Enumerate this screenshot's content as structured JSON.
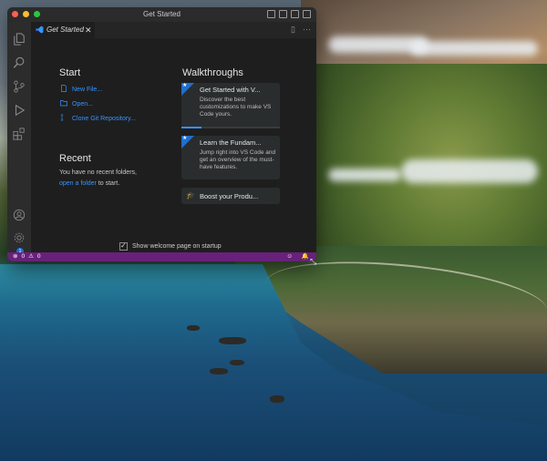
{
  "window": {
    "title": "Get Started"
  },
  "traffic_lights": {
    "close": "#ff5f57",
    "minimize": "#febc2e",
    "maximize": "#28c840"
  },
  "tab": {
    "label": "Get Started",
    "close": "✕"
  },
  "start": {
    "heading": "Start",
    "items": [
      {
        "label": "New File...",
        "icon": "new-file-icon"
      },
      {
        "label": "Open...",
        "icon": "folder-icon"
      },
      {
        "label": "Clone Git Repository...",
        "icon": "source-control-icon"
      }
    ]
  },
  "recent": {
    "heading": "Recent",
    "no_recent": "You have no recent folders,",
    "open_folder_link": "open a folder",
    "to_start": "to start."
  },
  "walkthroughs": {
    "heading": "Walkthroughs",
    "cards": [
      {
        "title": "Get Started with V...",
        "desc": "Discover the best customizations to make VS Code yours.",
        "progress": 0.2
      },
      {
        "title": "Learn the Fundam...",
        "desc": "Jump right into VS Code and get an overview of the must-have features."
      },
      {
        "title": "Boost your Produ...",
        "icon": "mortarboard-icon"
      }
    ]
  },
  "footer": {
    "show_welcome": "Show welcome page on startup",
    "checked": true
  },
  "statusbar": {
    "errors": "0",
    "warnings": "0",
    "color": "#68217a"
  },
  "accounts_badge": "1",
  "accent": "#3794ff"
}
